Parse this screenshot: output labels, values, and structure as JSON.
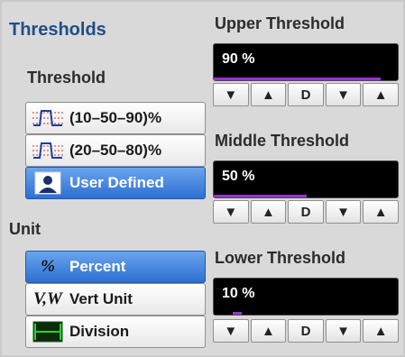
{
  "thresholds": {
    "title": "Thresholds",
    "threshold_heading": "Threshold",
    "options": [
      {
        "label": "(10–50–90)%",
        "icon": "pulse-edge-icon",
        "selected": false
      },
      {
        "label": "(20–50–80)%",
        "icon": "pulse-edge-icon",
        "selected": false
      },
      {
        "label": "User Defined",
        "icon": "user-icon",
        "selected": true
      }
    ],
    "unit_heading": "Unit",
    "units": [
      {
        "label": "Percent",
        "icon_text": "%",
        "icon": "percent-icon",
        "selected": true
      },
      {
        "label": "Vert Unit",
        "icon_text": "V,W",
        "icon": "vert-unit-icon",
        "selected": false
      },
      {
        "label": "Division",
        "icon": "division-icon",
        "selected": false
      }
    ]
  },
  "upper": {
    "label": "Upper Threshold",
    "value": "90 %",
    "level": 0.9
  },
  "middle": {
    "label": "Middle Threshold",
    "value": "50 %",
    "level": 0.5
  },
  "lower": {
    "label": "Lower Threshold",
    "value": "10 %",
    "level": 0.1
  },
  "controls": {
    "decrease": "▼",
    "increase": "▲",
    "default": "D",
    "coarse_decrease": "▼",
    "coarse_increase": "▲"
  },
  "colors": {
    "accent_blue": "#2d6fd3",
    "title_blue": "#1f4d8a",
    "level_bar": "#9a32d0"
  }
}
